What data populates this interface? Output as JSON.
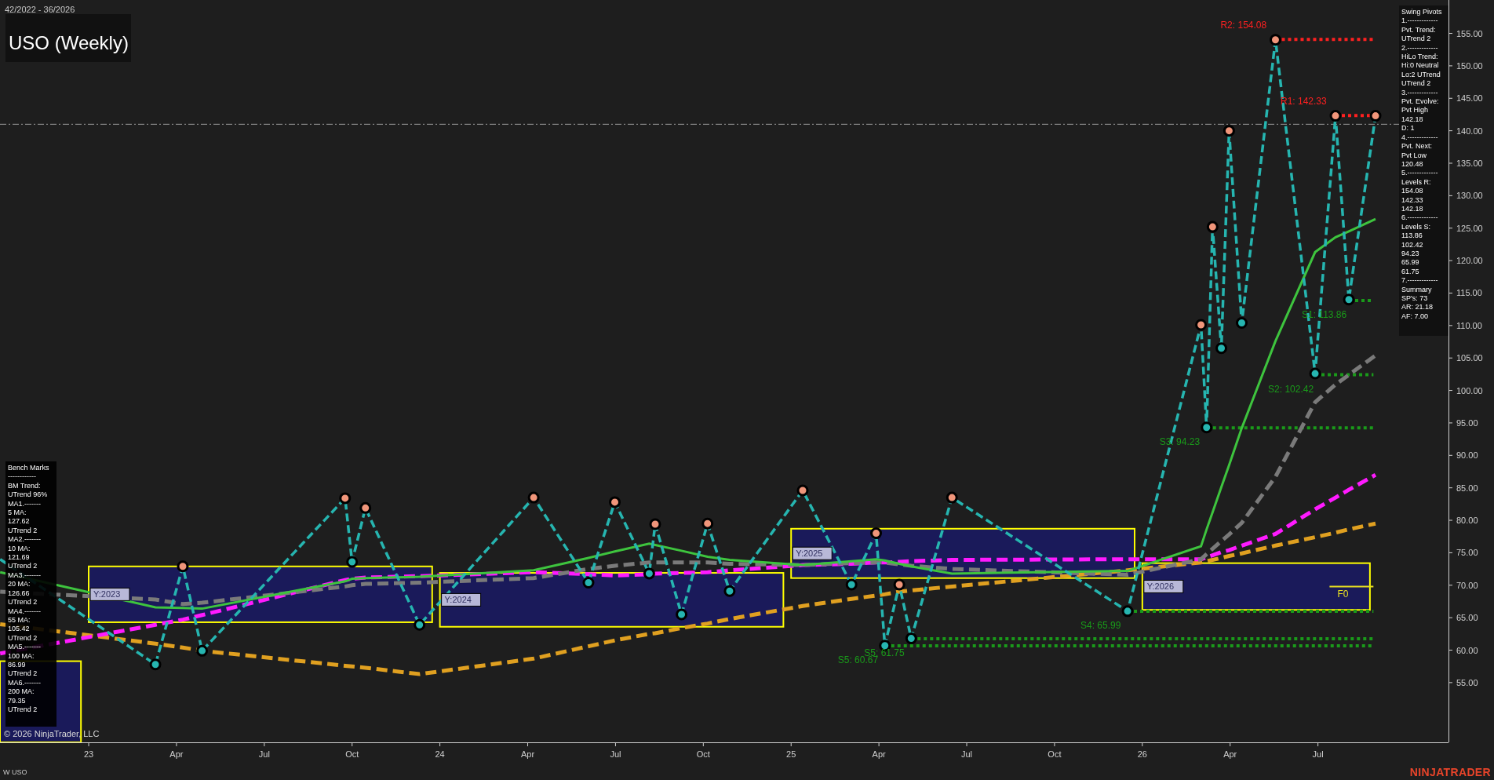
{
  "date_range": "42/2022 - 36/2026",
  "title": "USO (Weekly)",
  "chart_data": {
    "type": "line",
    "xlim": [
      22.7475,
      26.8717
    ],
    "ylim": [
      45.8,
      160.14
    ],
    "x": [
      22.748,
      23.19,
      23.268,
      23.323,
      23.73,
      23.75,
      23.788,
      23.942,
      24.267,
      24.423,
      24.498,
      24.596,
      24.613,
      24.688,
      24.762,
      24.825,
      25.033,
      25.172,
      25.242,
      25.267,
      25.308,
      25.342,
      25.458,
      25.958,
      26.167,
      26.183,
      26.2,
      26.225,
      26.247,
      26.283,
      26.379,
      26.492,
      26.55,
      26.588,
      26.664
    ],
    "xticks": [
      {
        "value": 23,
        "label": "23"
      },
      {
        "value": 23.25,
        "label": "Apr"
      },
      {
        "value": 23.5,
        "label": "Jul"
      },
      {
        "value": 23.75,
        "label": "Oct"
      },
      {
        "value": 24,
        "label": "24"
      },
      {
        "value": 24.25,
        "label": "Apr"
      },
      {
        "value": 24.5,
        "label": "Jul"
      },
      {
        "value": 24.75,
        "label": "Oct"
      },
      {
        "value": 25,
        "label": "25"
      },
      {
        "value": 25.25,
        "label": "Apr"
      },
      {
        "value": 25.5,
        "label": "Jul"
      },
      {
        "value": 25.75,
        "label": "Oct"
      },
      {
        "value": 26,
        "label": "26"
      },
      {
        "value": 26.25,
        "label": "Apr"
      },
      {
        "value": 26.5,
        "label": "Jul"
      }
    ],
    "yticks": [
      {
        "value": 55,
        "label": "55.00"
      },
      {
        "value": 60,
        "label": "60.00"
      },
      {
        "value": 65,
        "label": "65.00"
      },
      {
        "value": 70,
        "label": "70.00"
      },
      {
        "value": 75,
        "label": "75.00"
      },
      {
        "value": 80,
        "label": "80.00"
      },
      {
        "value": 85,
        "label": "85.00"
      },
      {
        "value": 90,
        "label": "90.00"
      },
      {
        "value": 95,
        "label": "95.00"
      },
      {
        "value": 100,
        "label": "100.00"
      },
      {
        "value": 105,
        "label": "105.00"
      },
      {
        "value": 110,
        "label": "110.00"
      },
      {
        "value": 115,
        "label": "115.00"
      },
      {
        "value": 120,
        "label": "120.00"
      },
      {
        "value": 125,
        "label": "125.00"
      },
      {
        "value": 130,
        "label": "130.00"
      },
      {
        "value": 135,
        "label": "135.00"
      },
      {
        "value": 140,
        "label": "140.00"
      },
      {
        "value": 145,
        "label": "145.00"
      },
      {
        "value": 150,
        "label": "150.00"
      },
      {
        "value": 155,
        "label": "155.00"
      }
    ],
    "series": [
      {
        "color": "#e0a020",
        "line_style": "dashed",
        "values": [
          64,
          61,
          60.4,
          59.9,
          57.6,
          57.5,
          57.3,
          56.3,
          58.7,
          60.6,
          61.5,
          62.5,
          62.6,
          63.4,
          64.1,
          64.8,
          66.8,
          67.9,
          68.4,
          68.6,
          69.0,
          69.2,
          69.8,
          72.3,
          73.5,
          73.7,
          73.9,
          74.2,
          74.5,
          74.9,
          76.1,
          77.4,
          78.1,
          78.6,
          79.5
        ]
      },
      {
        "color": "#ff1aff",
        "line_style": "dashed",
        "values": [
          59.5,
          63.9,
          64.7,
          65.4,
          70.8,
          71,
          71.2,
          71.4,
          72,
          71.7,
          71.5,
          71.7,
          71.8,
          71.9,
          72,
          72.3,
          73.1,
          73.3,
          73.5,
          73.5,
          73.6,
          73.7,
          73.9,
          74,
          74,
          74.3,
          74.6,
          75.1,
          75.4,
          76.1,
          77.9,
          81.7,
          83.5,
          84.7,
          87
        ]
      },
      {
        "color": "#7a7a7a",
        "line_style": "dashed",
        "values": [
          69,
          67.8,
          67.1,
          67.3,
          69.8,
          70,
          70.2,
          70.4,
          71.1,
          72.5,
          73,
          73.5,
          73.5,
          73.5,
          73.5,
          73.3,
          73.1,
          73.4,
          73.5,
          73.5,
          73.2,
          73,
          72.5,
          71.6,
          74,
          74.8,
          75.6,
          76.8,
          77.8,
          79.6,
          86.7,
          98.2,
          100.9,
          102.4,
          105.4
        ]
      },
      {
        "color": "#3ec43e",
        "line_style": "solid",
        "values": [
          72,
          66.6,
          66.5,
          66.4,
          70.6,
          71,
          71.1,
          71.3,
          72.3,
          74.2,
          75.2,
          76.4,
          76.2,
          75.3,
          74.4,
          73.9,
          73.1,
          73.7,
          74,
          73.8,
          73.3,
          72.9,
          71.8,
          72.2,
          76,
          78.6,
          81.2,
          85.1,
          88.5,
          94.2,
          107.6,
          121.3,
          123.6,
          124.5,
          126.4
        ]
      },
      {
        "color": "#26b5b0",
        "line_style": "dashed",
        "marker": "circle",
        "values": [
          74,
          57.8,
          72.9,
          59.9,
          83.4,
          73.6,
          81.9,
          63.9,
          83.5,
          70.4,
          82.8,
          71.8,
          79.4,
          65.5,
          79.5,
          69.1,
          84.6,
          70.1,
          78.0,
          60.7,
          70.1,
          61.8,
          83.5,
          66.0,
          110.1,
          94.3,
          125.2,
          106.5,
          140.0,
          110.4,
          154.0,
          102.6,
          142.3,
          114.0,
          142.3
        ]
      }
    ],
    "ref_lines": [
      {
        "axis": "y",
        "value": 141.0,
        "color": "#9a9a9a"
      },
      {
        "axis": "y",
        "value": 154.08,
        "label": "R2: 154.08",
        "color": "#ff2020"
      },
      {
        "axis": "y",
        "value": 142.33,
        "label": "R1: 142.33",
        "color": "#ff2020"
      },
      {
        "axis": "y",
        "value": 113.86,
        "label": "S1: 113.86",
        "color": "#1a9a1a"
      },
      {
        "axis": "y",
        "value": 102.42,
        "label": "S2: 102.42",
        "color": "#1a9a1a"
      },
      {
        "axis": "y",
        "value": 94.23,
        "label": "S3: 94.23",
        "color": "#1a9a1a"
      },
      {
        "axis": "y",
        "value": 65.99,
        "label": "S4: 65.99",
        "color": "#1a9a1a"
      },
      {
        "axis": "y",
        "value": 61.75,
        "label": "S5: 61.75",
        "color": "#1a9a1a"
      },
      {
        "axis": "y",
        "value": 60.67,
        "label": "S5: 60.67",
        "color": "#1a9a1a"
      },
      {
        "axis": "y",
        "value": 69.8,
        "label": "F0",
        "color": "#e8e020"
      }
    ],
    "bands": [
      {
        "axis": "y",
        "from": 45.8,
        "to": 58.3
      },
      {
        "axis": "y",
        "from": 64.3,
        "to": 72.9,
        "label": "Y:2023"
      },
      {
        "axis": "y",
        "from": 63.6,
        "to": 71.9,
        "label": "Y:2024"
      },
      {
        "axis": "y",
        "from": 71.1,
        "to": 78.7,
        "label": "Y:2025"
      },
      {
        "axis": "y",
        "from": 66.2,
        "to": 73.4,
        "label": "Y:2026"
      }
    ]
  },
  "swing_pivots": [
    "Swing Pivots",
    "1.-------------",
    "Pvt. Trend:",
    "UTrend 2",
    "2.-------------",
    "HiLo Trend:",
    "Hi:0 Neutral",
    "Lo:2 UTrend",
    "UTrend 2",
    "3.-------------",
    "Pvt. Evolve:",
    "Pvt High",
    "142.18",
    "D: 1",
    "4.-------------",
    "Pvt. Next:",
    "Pvt Low",
    "120.48",
    "5.-------------",
    "Levels R:",
    "154.08",
    "142.33",
    "142.18",
    "6.-------------",
    "Levels S:",
    "113.86",
    "102.42",
    "94.23",
    "65.99",
    "61.75",
    "7.-------------",
    "Summary",
    "SP's: 73",
    "AR: 21.18",
    "AF: 7.00"
  ],
  "bench_marks": [
    "Bench Marks",
    "------------",
    "BM Trend:",
    "UTrend 96%",
    "MA1.-------",
    "5 MA:",
    "127.62",
    "UTrend 2",
    "MA2.-------",
    "10 MA:",
    "121.69",
    "UTrend 2",
    "MA3.-------",
    "20 MA:",
    "126.66",
    "UTrend 2",
    "MA4.-------",
    "55 MA:",
    "105.42",
    "UTrend 2",
    "MA5.-------",
    "100 MA:",
    "86.99",
    "UTrend 2",
    "MA6.-------",
    "200 MA:",
    "79.35",
    "UTrend 2"
  ],
  "copyright": "© 2026 NinjaTrader, LLC",
  "instrument": "W USO",
  "logo": "NINJATRADER"
}
